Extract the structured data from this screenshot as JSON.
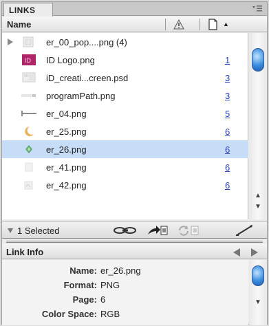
{
  "panel": {
    "tab_label": "LINKS",
    "menu_icon": "panel-menu-icon"
  },
  "columns": {
    "name": "Name",
    "status_icon": "warning-icon",
    "page_icon": "page-icon",
    "sort_icon": "sort-ascending-icon",
    "sort_glyph": "▲"
  },
  "links": [
    {
      "name": "er_00_pop....png (4)",
      "page": "",
      "thumb": "folder-group",
      "expandable": true
    },
    {
      "name": "ID Logo.png",
      "page": "1",
      "thumb": "id-logo"
    },
    {
      "name": "iD_creati...creen.psd",
      "page": "3",
      "thumb": "screen"
    },
    {
      "name": "programPath.png",
      "page": "3",
      "thumb": "path"
    },
    {
      "name": "er_04.png",
      "page": "5",
      "thumb": "line"
    },
    {
      "name": "er_25.png",
      "page": "6",
      "thumb": "moon"
    },
    {
      "name": "er_26.png",
      "page": "6",
      "thumb": "diamond",
      "selected": true
    },
    {
      "name": "er_41.png",
      "page": "6",
      "thumb": "faint"
    },
    {
      "name": "er_42.png",
      "page": "6",
      "thumb": "faint"
    }
  ],
  "status": {
    "selected_text": "1 Selected",
    "tools": [
      "relink-icon",
      "go-to-link-icon",
      "update-link-icon",
      "edit-original-icon"
    ]
  },
  "link_info": {
    "title": "Link Info",
    "rows": [
      {
        "key": "Name:",
        "value": "er_26.png"
      },
      {
        "key": "Format:",
        "value": "PNG"
      },
      {
        "key": "Page:",
        "value": "6"
      },
      {
        "key": "Color Space:",
        "value": "RGB"
      }
    ]
  },
  "colors": {
    "selection": "#c7dcf7",
    "page_link": "#2a3fb8",
    "scroll_knob": "#3b8ee0",
    "id_logo": "#b0246a"
  }
}
